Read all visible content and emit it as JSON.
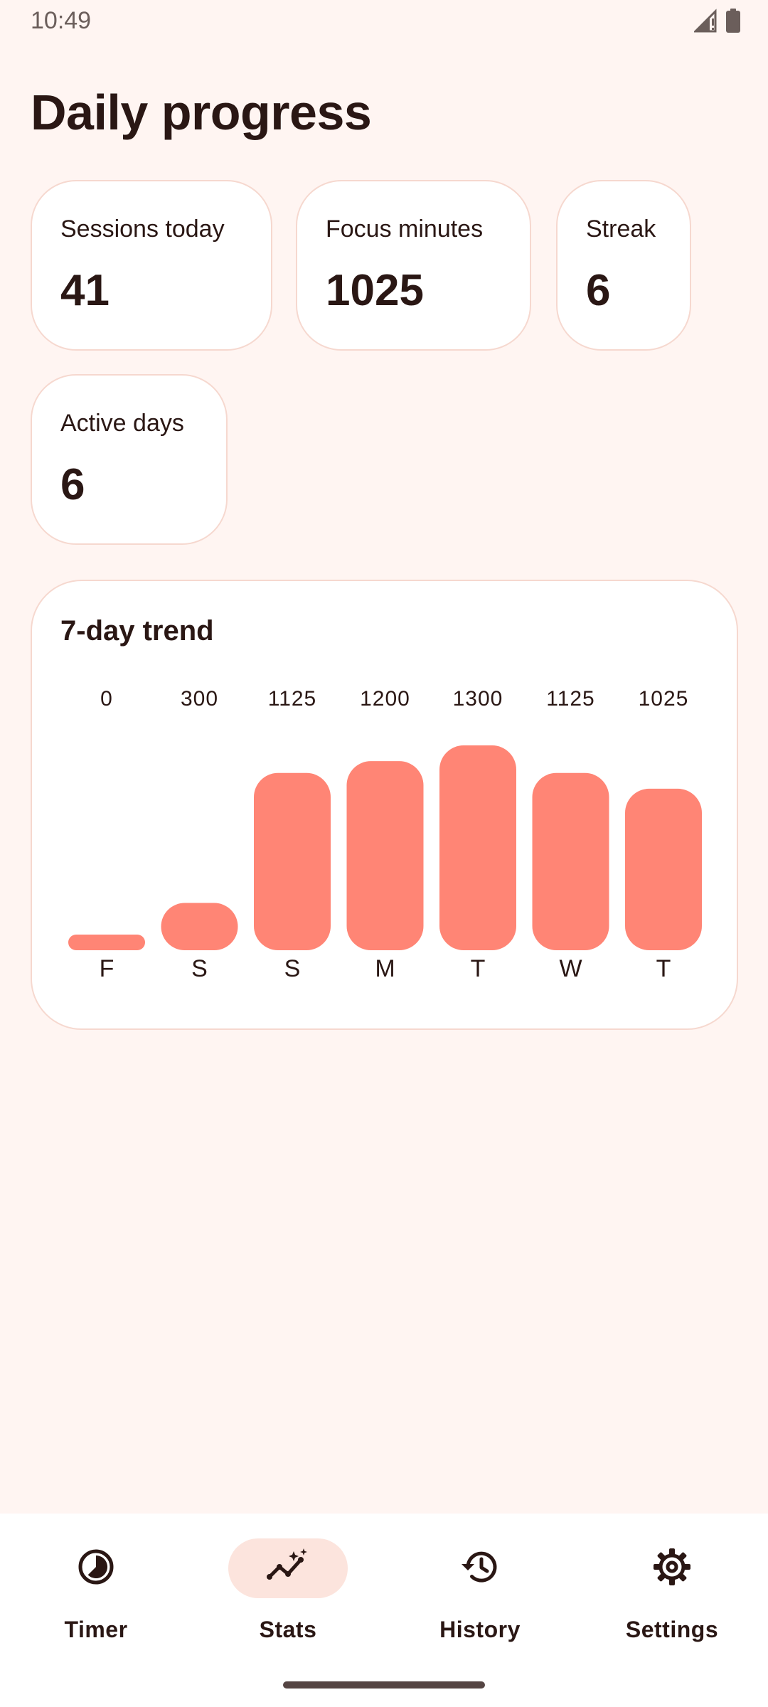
{
  "status_bar": {
    "time": "10:49",
    "icons": [
      "signal-icon",
      "battery-icon"
    ]
  },
  "page": {
    "title": "Daily progress"
  },
  "stats": [
    {
      "label": "Sessions today",
      "value": "41"
    },
    {
      "label": "Focus minutes",
      "value": "1025"
    },
    {
      "label": "Streak",
      "value": "6"
    },
    {
      "label": "Active days",
      "value": "6"
    }
  ],
  "trend": {
    "title": "7-day trend"
  },
  "chart_data": {
    "type": "bar",
    "title": "7-day trend",
    "categories": [
      "F",
      "S",
      "S",
      "M",
      "T",
      "W",
      "T"
    ],
    "values": [
      0,
      300,
      1125,
      1200,
      1300,
      1125,
      1025
    ],
    "value_labels": [
      "0",
      "300",
      "1125",
      "1200",
      "1300",
      "1125",
      "1025"
    ],
    "ylim": [
      0,
      1300
    ],
    "grid": false,
    "legend": "none",
    "bar_color": "#FF8575"
  },
  "nav": {
    "items": [
      {
        "label": "Timer",
        "icon": "timer-icon",
        "active": false
      },
      {
        "label": "Stats",
        "icon": "stats-icon",
        "active": true
      },
      {
        "label": "History",
        "icon": "history-icon",
        "active": false
      },
      {
        "label": "Settings",
        "icon": "gear-icon",
        "active": false
      }
    ]
  },
  "colors": {
    "background": "#FFF5F2",
    "card": "#FFFFFF",
    "card_border": "#F6D8CF",
    "accent": "#FF8575",
    "active_nav": "#FCE4DD",
    "text": "#2A1714"
  }
}
